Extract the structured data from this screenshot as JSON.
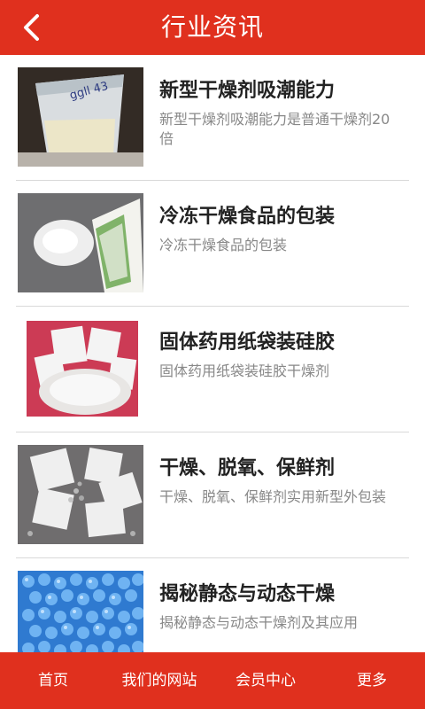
{
  "header": {
    "title": "行业资讯",
    "back_icon": "chevron-left-icon"
  },
  "colors": {
    "accent": "#e0301e",
    "title_text": "#222222",
    "desc_text": "#888888",
    "divider": "#d9d9d9"
  },
  "news": [
    {
      "title": "新型干燥剂吸潮能力",
      "desc": "新型干燥剂吸潮能力是普通干燥剂20倍",
      "image": "desiccant-cup-photo"
    },
    {
      "title": "冷冻干燥食品的包装",
      "desc": "冷冻干燥食品的包装",
      "image": "white-powder-packet-photo"
    },
    {
      "title": "固体药用纸袋装硅胶",
      "desc": "固体药用纸袋装硅胶干燥剂",
      "image": "silica-gel-packets-photo"
    },
    {
      "title": "干燥、脱氧、保鲜剂",
      "desc": "干燥、脱氧、保鲜剂实用新型外包装",
      "image": "oxygen-absorber-packets-photo"
    },
    {
      "title": "揭秘静态与动态干燥",
      "desc": "揭秘静态与动态干燥剂及其应用",
      "image": "blue-silica-beads-photo"
    }
  ],
  "tabbar": {
    "items": [
      "首页",
      "我们的网站",
      "会员中心",
      "更多"
    ]
  }
}
